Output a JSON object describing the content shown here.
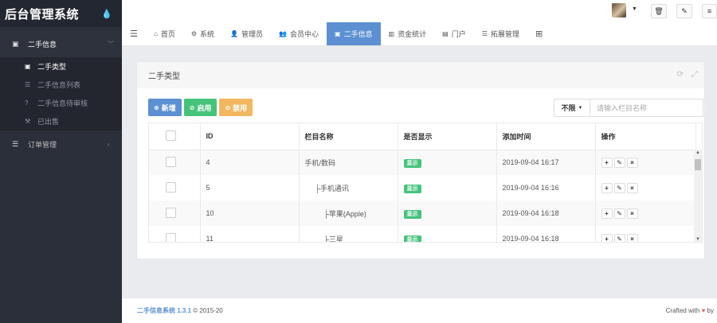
{
  "brand": {
    "title": "后台管理系统",
    "drop_icon": "💧"
  },
  "sidebar": {
    "groups": [
      {
        "label": "二手信息",
        "icon": "image-icon",
        "arrow": "﹀"
      },
      {
        "label": "订单管理",
        "icon": "list-icon",
        "arrow": "‹"
      }
    ],
    "items": [
      {
        "label": "二手类型",
        "active": true
      },
      {
        "label": "二手信息列表",
        "active": false
      },
      {
        "label": "二手信息待审核",
        "active": false
      },
      {
        "label": "已出售",
        "active": false
      }
    ]
  },
  "nav": {
    "items": [
      {
        "label": "首页",
        "icon": "home-icon"
      },
      {
        "label": "系统",
        "icon": "gear-icon"
      },
      {
        "label": "管理员",
        "icon": "user-icon"
      },
      {
        "label": "会员中心",
        "icon": "users-icon"
      },
      {
        "label": "二手信息",
        "icon": "image-icon"
      },
      {
        "label": "资金统计",
        "icon": "bar-chart-icon"
      },
      {
        "label": "门户",
        "icon": "newspaper-icon"
      },
      {
        "label": "拓展管理",
        "icon": "list-icon"
      }
    ],
    "active_index": 4
  },
  "panel": {
    "title": "二手类型"
  },
  "toolbar": {
    "add_label": "新增",
    "enable_label": "启用",
    "disable_label": "禁用"
  },
  "search": {
    "select_value": "不限",
    "placeholder": "请输入栏目名称"
  },
  "table": {
    "headers": [
      "",
      "ID",
      "栏目名称",
      "是否显示",
      "添加时间",
      "操作"
    ],
    "rows": [
      {
        "id": "4",
        "name": "手机/数码",
        "indent": 0,
        "show": "显示",
        "time": "2019-09-04 16:17"
      },
      {
        "id": "5",
        "name": "├手机通讯",
        "indent": 1,
        "show": "显示",
        "time": "2019-09-04 16:16"
      },
      {
        "id": "10",
        "name": "├苹果(Apple)",
        "indent": 2,
        "show": "显示",
        "time": "2019-09-04 16:18"
      },
      {
        "id": "11",
        "name": "├三星",
        "indent": 2,
        "show": "显示",
        "time": "2019-09-04 16:18"
      }
    ]
  },
  "footer": {
    "name": "二手信息系统 1.3.1",
    "copy": "© 2015-20",
    "right": "Crafted with",
    "by": "by"
  },
  "colors": {
    "sidebar": "#2b2f3a",
    "primary": "#5c90d2",
    "success": "#46c37b",
    "warning": "#f3b760"
  }
}
